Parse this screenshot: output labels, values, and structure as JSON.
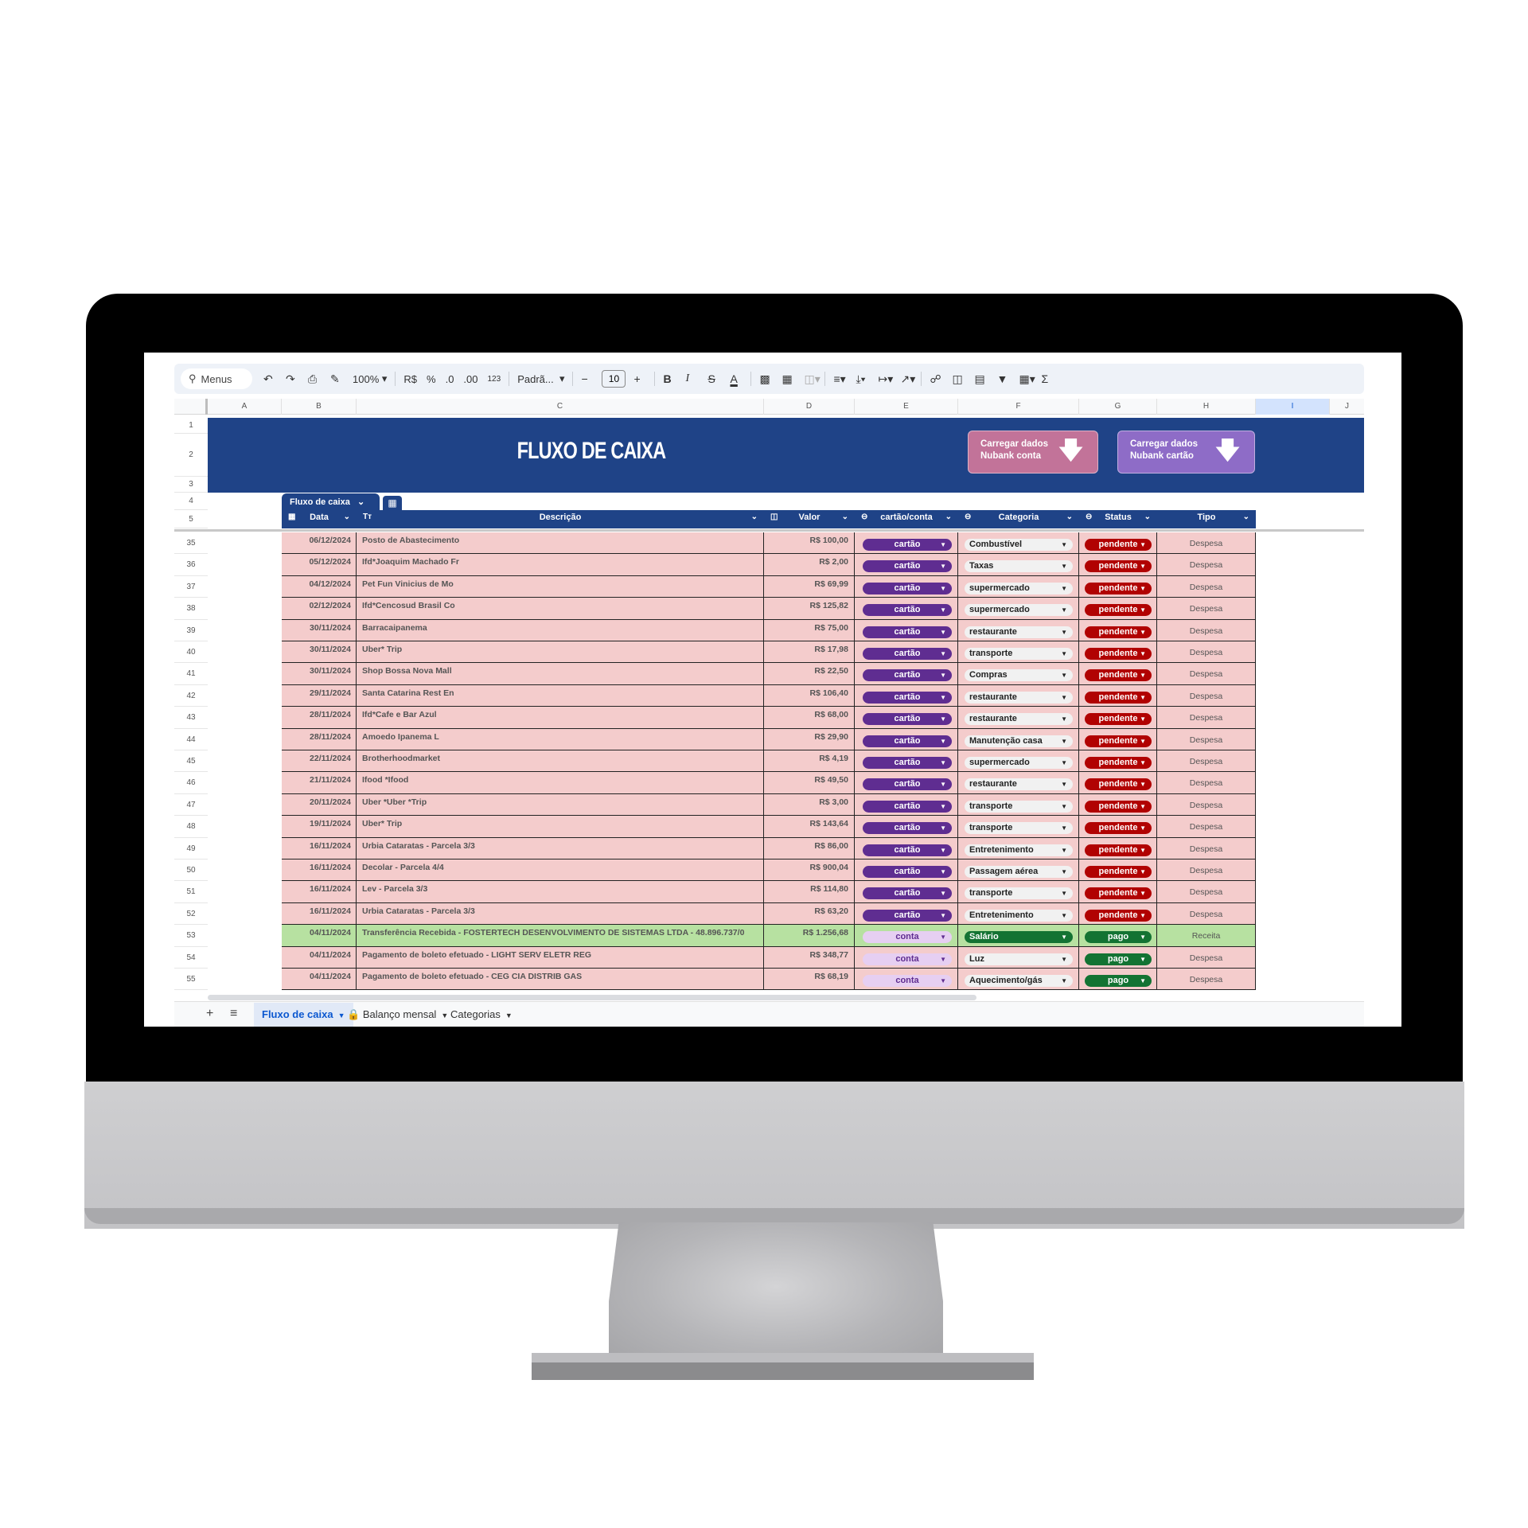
{
  "toolbar": {
    "search_label": "Menus",
    "zoom": "100%",
    "currency": "R$",
    "percent": "%",
    "dec_decrease": ".0",
    "dec_increase": ".00",
    "number_format": "123",
    "font": "Padrã...",
    "font_size": "10",
    "bold": "B",
    "italic": "I",
    "strike": "S",
    "text_color": "A",
    "sum": "Σ"
  },
  "columns": [
    "A",
    "B",
    "C",
    "D",
    "E",
    "F",
    "G",
    "H",
    "I",
    "J"
  ],
  "row_numbers_top": [
    "1",
    "2",
    "3",
    "4",
    "5"
  ],
  "banner": {
    "title": "FLUXO DE CAIXA",
    "button_conta": [
      "Carregar dados",
      "Nubank conta"
    ],
    "button_cartao": [
      "Carregar dados",
      "Nubank cartão"
    ],
    "button_conta_color": "#c27399",
    "button_cartao_color": "#8e6cc7"
  },
  "table": {
    "name": "Fluxo de caixa",
    "headers": {
      "data": "Data",
      "descricao": "Descrição",
      "valor": "Valor",
      "cartao_conta": "cartão/conta",
      "categoria": "Categoria",
      "status": "Status",
      "tipo": "Tipo"
    },
    "header_color": "#1f4387",
    "rows": [
      {
        "n": "35",
        "date": "06/12/2024",
        "desc": "Posto de Abastecimento",
        "value": "R$ 100,00",
        "account": "cartão",
        "category": "Combustível",
        "status": "pendente",
        "type": "Despesa"
      },
      {
        "n": "36",
        "date": "05/12/2024",
        "desc": "Ifd*Joaquim Machado Fr",
        "value": "R$ 2,00",
        "account": "cartão",
        "category": "Taxas",
        "status": "pendente",
        "type": "Despesa"
      },
      {
        "n": "37",
        "date": "04/12/2024",
        "desc": "Pet Fun Vinicius de Mo",
        "value": "R$ 69,99",
        "account": "cartão",
        "category": "supermercado",
        "status": "pendente",
        "type": "Despesa"
      },
      {
        "n": "38",
        "date": "02/12/2024",
        "desc": "Ifd*Cencosud Brasil Co",
        "value": "R$ 125,82",
        "account": "cartão",
        "category": "supermercado",
        "status": "pendente",
        "type": "Despesa"
      },
      {
        "n": "39",
        "date": "30/11/2024",
        "desc": "Barracaipanema",
        "value": "R$ 75,00",
        "account": "cartão",
        "category": "restaurante",
        "status": "pendente",
        "type": "Despesa"
      },
      {
        "n": "40",
        "date": "30/11/2024",
        "desc": "Uber* Trip",
        "value": "R$ 17,98",
        "account": "cartão",
        "category": "transporte",
        "status": "pendente",
        "type": "Despesa"
      },
      {
        "n": "41",
        "date": "30/11/2024",
        "desc": "Shop Bossa Nova Mall",
        "value": "R$ 22,50",
        "account": "cartão",
        "category": "Compras",
        "status": "pendente",
        "type": "Despesa"
      },
      {
        "n": "42",
        "date": "29/11/2024",
        "desc": "Santa Catarina Rest En",
        "value": "R$ 106,40",
        "account": "cartão",
        "category": "restaurante",
        "status": "pendente",
        "type": "Despesa"
      },
      {
        "n": "43",
        "date": "28/11/2024",
        "desc": "Ifd*Cafe e Bar Azul",
        "value": "R$ 68,00",
        "account": "cartão",
        "category": "restaurante",
        "status": "pendente",
        "type": "Despesa"
      },
      {
        "n": "44",
        "date": "28/11/2024",
        "desc": "Amoedo Ipanema L",
        "value": "R$ 29,90",
        "account": "cartão",
        "category": "Manutenção casa",
        "status": "pendente",
        "type": "Despesa"
      },
      {
        "n": "45",
        "date": "22/11/2024",
        "desc": "Brotherhoodmarket",
        "value": "R$ 4,19",
        "account": "cartão",
        "category": "supermercado",
        "status": "pendente",
        "type": "Despesa"
      },
      {
        "n": "46",
        "date": "21/11/2024",
        "desc": "Ifood *Ifood",
        "value": "R$ 49,50",
        "account": "cartão",
        "category": "restaurante",
        "status": "pendente",
        "type": "Despesa"
      },
      {
        "n": "47",
        "date": "20/11/2024",
        "desc": "Uber *Uber *Trip",
        "value": "R$ 3,00",
        "account": "cartão",
        "category": "transporte",
        "status": "pendente",
        "type": "Despesa"
      },
      {
        "n": "48",
        "date": "19/11/2024",
        "desc": "Uber* Trip",
        "value": "R$ 143,64",
        "account": "cartão",
        "category": "transporte",
        "status": "pendente",
        "type": "Despesa"
      },
      {
        "n": "49",
        "date": "16/11/2024",
        "desc": "Urbia Cataratas - Parcela 3/3",
        "value": "R$ 86,00",
        "account": "cartão",
        "category": "Entretenimento",
        "status": "pendente",
        "type": "Despesa"
      },
      {
        "n": "50",
        "date": "16/11/2024",
        "desc": "Decolar - Parcela 4/4",
        "value": "R$ 900,04",
        "account": "cartão",
        "category": "Passagem aérea",
        "status": "pendente",
        "type": "Despesa"
      },
      {
        "n": "51",
        "date": "16/11/2024",
        "desc": "Lev - Parcela 3/3",
        "value": "R$ 114,80",
        "account": "cartão",
        "category": "transporte",
        "status": "pendente",
        "type": "Despesa"
      },
      {
        "n": "52",
        "date": "16/11/2024",
        "desc": "Urbia Cataratas - Parcela 3/3",
        "value": "R$ 63,20",
        "account": "cartão",
        "category": "Entretenimento",
        "status": "pendente",
        "type": "Despesa"
      },
      {
        "n": "53",
        "date": "04/11/2024",
        "desc": "Transferência Recebida - FOSTERTECH DESENVOLVIMENTO DE SISTEMAS LTDA - 48.896.737/0",
        "value": "R$ 1.256,68",
        "account": "conta",
        "category": "Salário",
        "status": "pago",
        "type": "Receita"
      },
      {
        "n": "54",
        "date": "04/11/2024",
        "desc": "Pagamento de boleto efetuado - LIGHT SERV ELETR REG",
        "value": "R$ 348,77",
        "account": "conta",
        "category": "Luz",
        "status": "pago",
        "type": "Despesa"
      },
      {
        "n": "55",
        "date": "04/11/2024",
        "desc": "Pagamento de boleto efetuado - CEG CIA DISTRIB GAS",
        "value": "R$ 68,19",
        "account": "conta",
        "category": "Aquecimento/gás",
        "status": "pago",
        "type": "Despesa"
      }
    ]
  },
  "sheets": [
    {
      "label": "Fluxo de caixa",
      "active": true,
      "locked": false
    },
    {
      "label": "Balanço mensal",
      "active": false,
      "locked": true
    },
    {
      "label": "Categorias",
      "active": false,
      "locked": false
    }
  ],
  "colors": {
    "despesa_row": "#f4cccc",
    "receita_row": "#b7e1a1",
    "cartao_chip": "#5f2d91",
    "conta_chip": "#e6cff2",
    "pendente_chip": "#b10202",
    "pago_chip": "#137333"
  }
}
